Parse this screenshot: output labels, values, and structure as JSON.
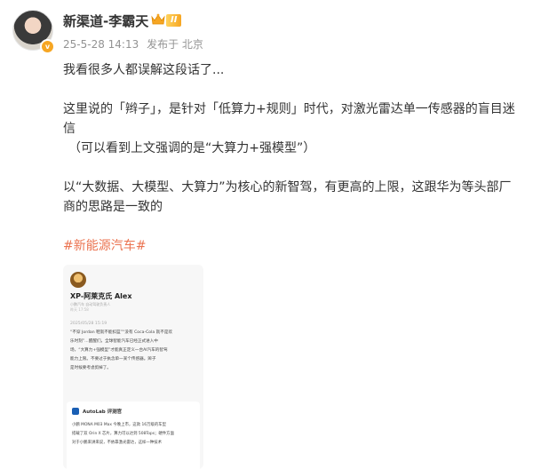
{
  "author": {
    "name": "新渠道-李霸天",
    "level": "II",
    "verified_badge": "v",
    "icons": [
      "crown-icon",
      "verified-icon"
    ]
  },
  "meta": {
    "time": "25-5-28 14:13",
    "source": "发布于 北京"
  },
  "post": {
    "line1": "我看很多人都误解这段话了...",
    "line2": "这里说的「辫子」，是针对「低算力+规则」时代，对激光雷达单一传感器的盲目迷信",
    "line3": "（可以看到上文强调的是“大算力+强模型”）",
    "line4": "以“大数据、大模型、大算力”为核心的新智驾，有更高的上限，这跟华为等头部厂商的思路是一致的",
    "hashtag": "#新能源汽车#"
  },
  "card": {
    "name": "XP-阿莱克氏 Alex",
    "sub1": "小鹏汽车 自动驾驶负责人",
    "sub2": "昨天 17:58",
    "date": "2025/05/28 15:19",
    "lines": [
      "“不穿 Jordan 鞋就不能扣篮”“没有 Coca-Cola 就不是欢",
      "乐时刻”…醒醒们，全球智能汽车已经正式进入中",
      "场，“大算力+强模型”才能真正定义一台AI汽车的智驾",
      "能力上限。不要过于执念单一某个传感器。辫子",
      "是时候要考虑剪掉了。"
    ],
    "quoted_name": "AutoLab 评测官",
    "quoted_lines": [
      "小鹏 MONA M03 Max 今晚上市，这款 16万级的车型",
      "搭载了双 Orin X 芯片，算力可以达到 508Tops；硬件方面",
      "对于小鹏来讲来说，不依靠激光雷达，这样一种技术"
    ]
  }
}
